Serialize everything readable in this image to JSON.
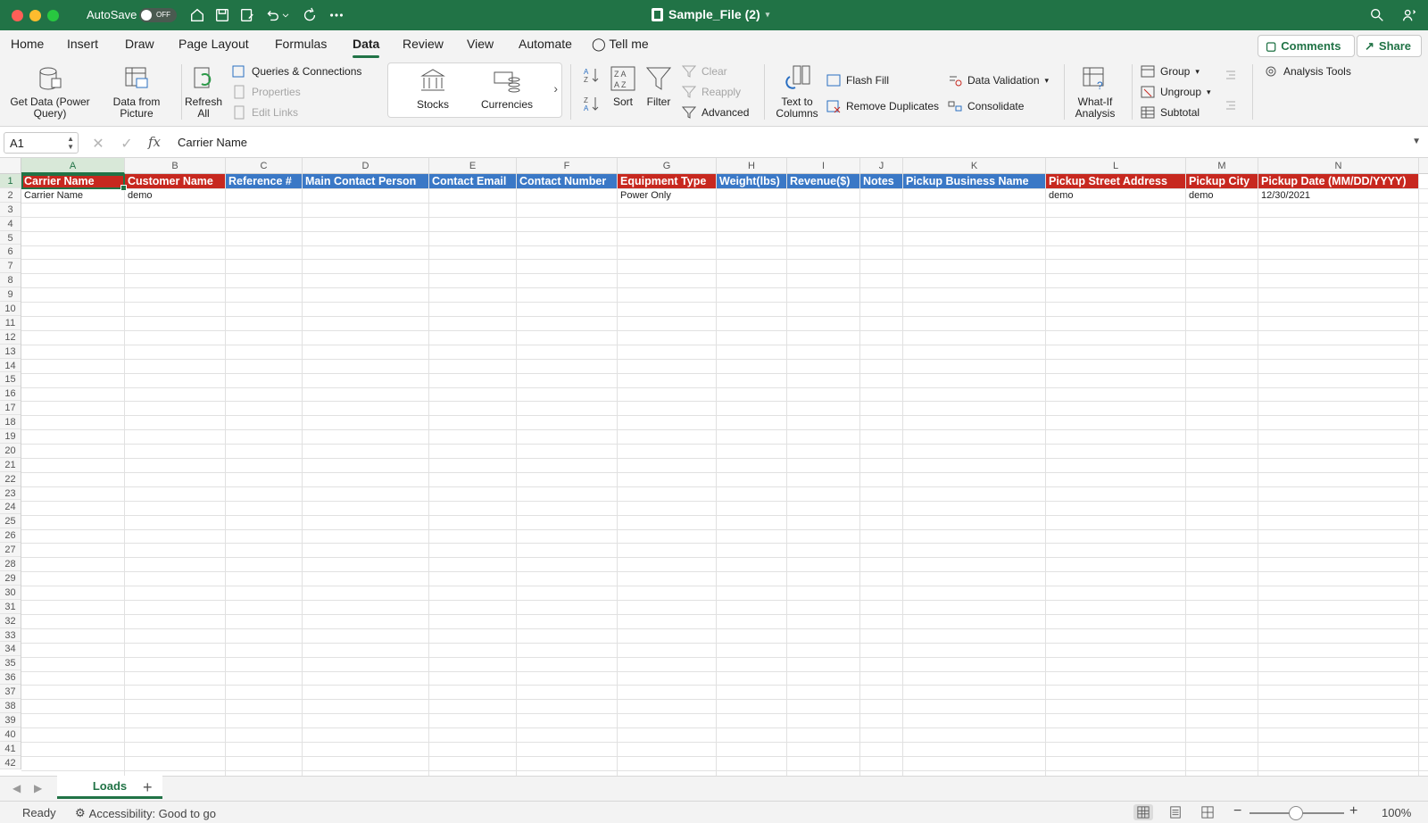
{
  "titlebar": {
    "autosave_label": "AutoSave",
    "autosave_state": "OFF",
    "document_title": "Sample_File (2)",
    "accent": "#217346"
  },
  "tabs": [
    "Home",
    "Insert",
    "Draw",
    "Page Layout",
    "Formulas",
    "Data",
    "Review",
    "View",
    "Automate"
  ],
  "active_tab": "Data",
  "tell_me": "Tell me",
  "comments_label": "Comments",
  "share_label": "Share",
  "ribbon": {
    "get_data": "Get Data (Power Query)",
    "data_from_picture": "Data from Picture",
    "refresh_all": "Refresh All",
    "queries_connections": "Queries & Connections",
    "properties": "Properties",
    "edit_links": "Edit Links",
    "stocks": "Stocks",
    "currencies": "Currencies",
    "sort": "Sort",
    "filter": "Filter",
    "clear": "Clear",
    "reapply": "Reapply",
    "advanced": "Advanced",
    "text_to_columns": "Text to Columns",
    "flash_fill": "Flash Fill",
    "remove_duplicates": "Remove Duplicates",
    "data_validation": "Data Validation",
    "consolidate": "Consolidate",
    "what_if": "What-If Analysis",
    "group": "Group",
    "ungroup": "Ungroup",
    "subtotal": "Subtotal",
    "analysis_tools": "Analysis Tools"
  },
  "formula_bar": {
    "name_box": "A1",
    "fx": "fx",
    "content": "Carrier Name"
  },
  "columns": [
    {
      "letter": "A",
      "header": "Carrier Name",
      "color": "red",
      "row2": "Carrier Name"
    },
    {
      "letter": "B",
      "header": "Customer Name",
      "color": "red",
      "row2": "demo"
    },
    {
      "letter": "C",
      "header": "Reference #",
      "color": "blue",
      "row2": ""
    },
    {
      "letter": "D",
      "header": "Main Contact Person",
      "color": "blue",
      "row2": ""
    },
    {
      "letter": "E",
      "header": "Contact Email",
      "color": "blue",
      "row2": ""
    },
    {
      "letter": "F",
      "header": "Contact Number",
      "color": "blue",
      "row2": ""
    },
    {
      "letter": "G",
      "header": "Equipment Type",
      "color": "red",
      "row2": "Power Only"
    },
    {
      "letter": "H",
      "header": "Weight(lbs)",
      "color": "blue",
      "row2": ""
    },
    {
      "letter": "I",
      "header": "Revenue($)",
      "color": "blue",
      "row2": ""
    },
    {
      "letter": "J",
      "header": "Notes",
      "color": "blue",
      "row2": ""
    },
    {
      "letter": "K",
      "header": "Pickup Business Name",
      "color": "blue",
      "row2": ""
    },
    {
      "letter": "L",
      "header": "Pickup Street Address",
      "color": "red",
      "row2": "demo"
    },
    {
      "letter": "M",
      "header": "Pickup City",
      "color": "red",
      "row2": "demo"
    },
    {
      "letter": "N",
      "header": "Pickup Date  (MM/DD/YYYY)",
      "color": "red",
      "row2": "12/30/2021"
    }
  ],
  "header_colors": {
    "red": "#c7281f",
    "blue": "#3a78c6"
  },
  "row_count": 42,
  "sheet_tabs": [
    "Loads"
  ],
  "status": {
    "ready": "Ready",
    "accessibility": "Accessibility: Good to go",
    "zoom": "100%"
  }
}
